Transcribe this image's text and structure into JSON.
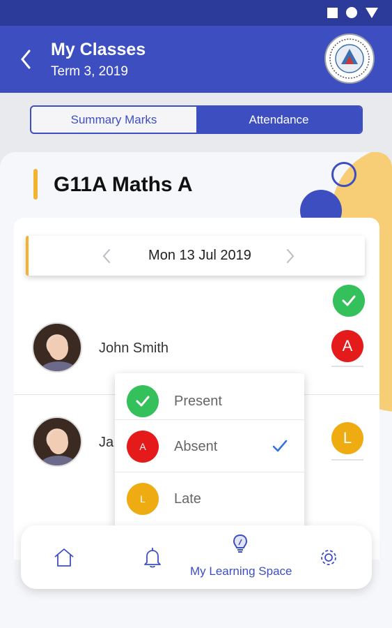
{
  "header": {
    "title": "My Classes",
    "subtitle": "Term 3, 2019"
  },
  "tabs": [
    {
      "label": "Summary Marks",
      "active": false
    },
    {
      "label": "Attendance",
      "active": true
    }
  ],
  "class_title": "G11A Maths A",
  "date": {
    "label": "Mon 13 Jul 2019"
  },
  "students": [
    {
      "name": "John Smith",
      "status": "Absent",
      "status_letter": "A"
    },
    {
      "name": "Ja",
      "status": "Late",
      "status_letter": "L"
    }
  ],
  "dropdown": {
    "options": [
      {
        "label": "Present",
        "letter": "",
        "color": "#34c05a"
      },
      {
        "label": "Absent",
        "letter": "A",
        "color": "#e51a1a"
      },
      {
        "label": "Late",
        "letter": "L",
        "color": "#eeab12"
      }
    ],
    "selected": "Absent"
  },
  "bottom_nav": {
    "items": [
      {
        "icon": "home-icon"
      },
      {
        "icon": "bell-icon"
      },
      {
        "icon": "lightbulb-icon",
        "label": "My Learning Space",
        "active": true
      },
      {
        "icon": "gear-icon"
      }
    ]
  },
  "colors": {
    "primary": "#3d4fc0",
    "status_bar": "#2c3a9a",
    "accent": "#f2b430",
    "present": "#34c05a",
    "absent": "#e51a1a",
    "late": "#eeab12"
  }
}
